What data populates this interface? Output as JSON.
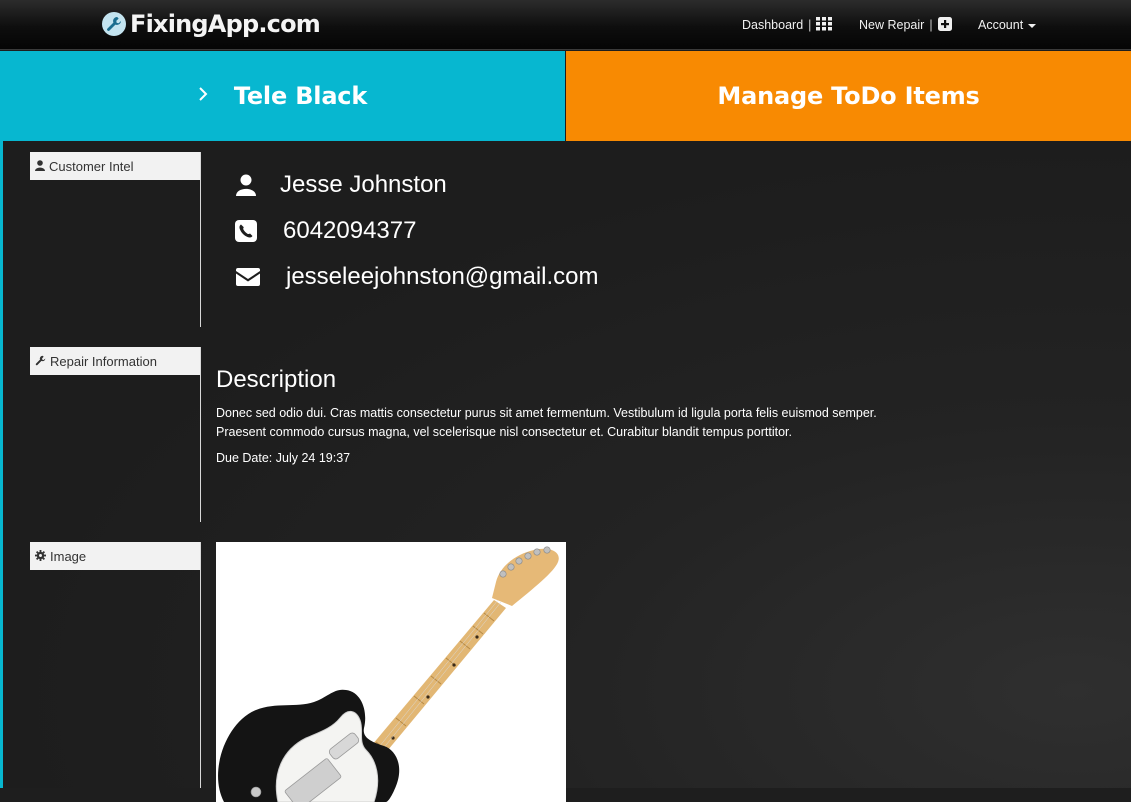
{
  "brand": {
    "name": "FixingApp.com",
    "icon": "wrench-icon"
  },
  "nav": {
    "dashboard_label": "Dashboard",
    "dashboard_sep": "|",
    "dashboard_icon": "grid-icon",
    "new_repair_label": "New Repair",
    "new_repair_sep": "|",
    "new_repair_icon": "plus-square-icon",
    "account_label": "Account",
    "account_icon": "caret-down-icon"
  },
  "banner": {
    "left_title": "Tele Black",
    "left_icon": "chevron-right-icon",
    "right_title": "Manage ToDo Items",
    "left_color": "#07b7d0",
    "right_color": "#f88a02"
  },
  "sections": {
    "customer_intel": {
      "label": "Customer Intel",
      "icon": "user-icon"
    },
    "repair_info": {
      "label": "Repair Information",
      "icon": "wrench-icon"
    },
    "image": {
      "label": "Image",
      "icon": "gear-icon"
    }
  },
  "customer": {
    "name": "Jesse Johnston",
    "phone": "6042094377",
    "email": "jesseleejohnston@gmail.com"
  },
  "repair": {
    "title": "Description",
    "description_line1": "Donec sed odio dui. Cras mattis consectetur purus sit amet fermentum. Vestibulum id ligula porta felis euismod semper.",
    "description_line2": "Praesent commodo cursus magna, vel scelerisque nisl consectetur et. Curabitur blandit tempus porttitor.",
    "due_date": "Due Date: July 24 19:37"
  }
}
